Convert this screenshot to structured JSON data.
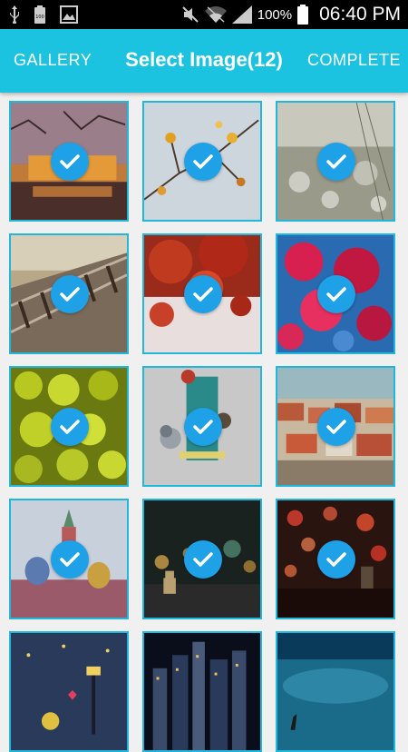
{
  "status_bar": {
    "battery_percent": "100%",
    "time": "06:40 PM",
    "icons": [
      "usb-icon",
      "battery-small-icon",
      "image-icon",
      "mute-icon",
      "wifi-icon",
      "signal-icon",
      "battery-icon"
    ]
  },
  "app_bar": {
    "gallery_label": "GALLERY",
    "title": "Select Image(12)",
    "complete_label": "COMPLETE",
    "color": "#1cc3e0"
  },
  "grid": {
    "check_color": "#1ea1e6",
    "border_color": "#21b7dc",
    "images": [
      {
        "subject": "lake-palace-night",
        "selected": true
      },
      {
        "subject": "autumn-branch-leaves",
        "selected": true
      },
      {
        "subject": "dandelion-field",
        "selected": true
      },
      {
        "subject": "railway-track",
        "selected": true
      },
      {
        "subject": "red-maple-leaves",
        "selected": true
      },
      {
        "subject": "red-blossoms",
        "selected": true
      },
      {
        "subject": "green-yellow-leaves",
        "selected": true
      },
      {
        "subject": "bird-feeder",
        "selected": true
      },
      {
        "subject": "tiled-rooftops-town",
        "selected": true
      },
      {
        "subject": "onion-dome-cathedral",
        "selected": true
      },
      {
        "subject": "cardboard-robot-city-lights",
        "selected": true
      },
      {
        "subject": "heart-bokeh-robot",
        "selected": true
      },
      {
        "subject": "cartoon-streetlamp-night",
        "selected": false
      },
      {
        "subject": "city-skyline-night",
        "selected": false
      },
      {
        "subject": "heron-blue-water",
        "selected": false
      }
    ]
  }
}
